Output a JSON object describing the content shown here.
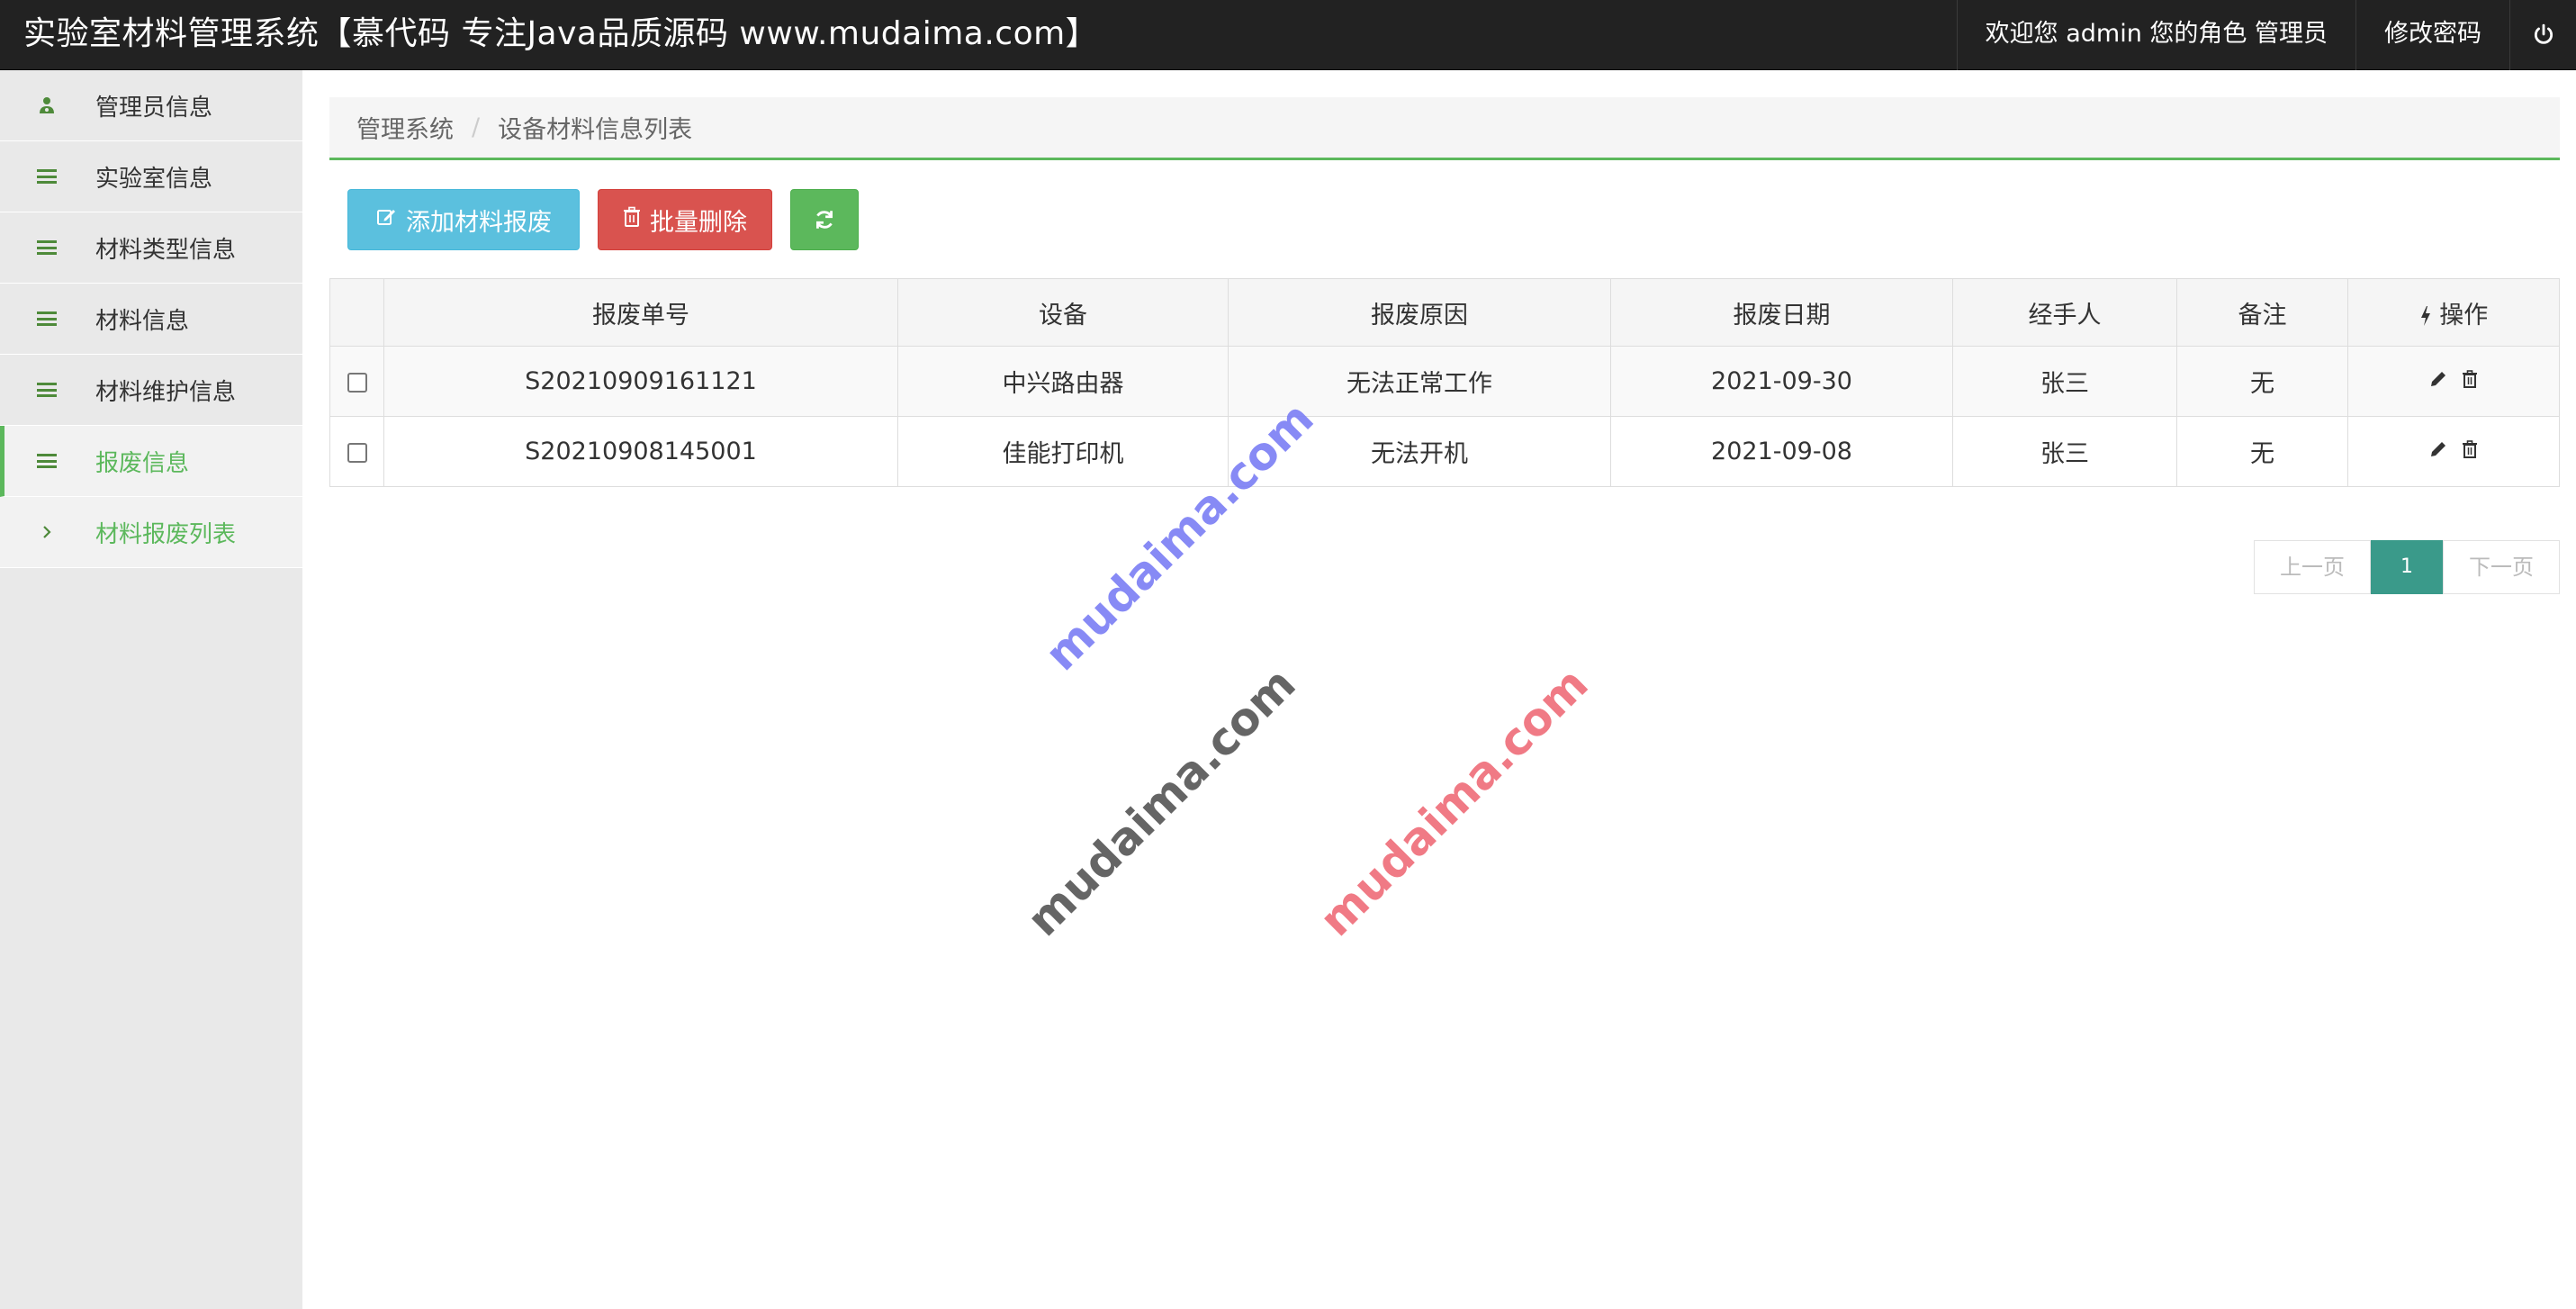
{
  "header": {
    "brand": "实验室材料管理系统【慕代码 专注Java品质源码 www.mudaima.com】",
    "welcome": "欢迎您 admin 您的角色 管理员",
    "change_password": "修改密码",
    "logout_icon": "power-icon"
  },
  "sidebar": {
    "items": [
      {
        "label": "管理员信息",
        "icon": "users-icon"
      },
      {
        "label": "实验室信息",
        "icon": "bars-icon"
      },
      {
        "label": "材料类型信息",
        "icon": "bars-icon"
      },
      {
        "label": "材料信息",
        "icon": "bars-icon"
      },
      {
        "label": "材料维护信息",
        "icon": "bars-icon"
      },
      {
        "label": "报废信息",
        "icon": "bars-icon",
        "active": true
      },
      {
        "label": "材料报废列表",
        "icon": "chevron-right-icon",
        "sub": true
      }
    ]
  },
  "breadcrumb": {
    "root": "管理系统",
    "separator": "/",
    "current": "设备材料信息列表"
  },
  "toolbar": {
    "add_label": "添加材料报废",
    "batch_delete_label": "批量删除",
    "refresh_icon": "refresh-icon"
  },
  "table": {
    "headers": [
      "报废单号",
      "设备",
      "报废原因",
      "报废日期",
      "经手人",
      "备注",
      "操作"
    ],
    "rows": [
      {
        "id": "S20210909161121",
        "device": "中兴路由器",
        "reason": "无法正常工作",
        "date": "2021-09-30",
        "handler": "张三",
        "note": "无"
      },
      {
        "id": "S20210908145001",
        "device": "佳能打印机",
        "reason": "无法开机",
        "date": "2021-09-08",
        "handler": "张三",
        "note": "无"
      }
    ]
  },
  "pagination": {
    "prev": "上一页",
    "current": "1",
    "next": "下一页"
  },
  "watermarks": [
    "mudaima.com",
    "mudaima.com",
    "mudaima.com"
  ],
  "colors": {
    "navbar": "#222222",
    "accent": "#5cb85c",
    "info": "#5bc0de",
    "danger": "#d9534f",
    "page_active": "#3a9a8a"
  }
}
